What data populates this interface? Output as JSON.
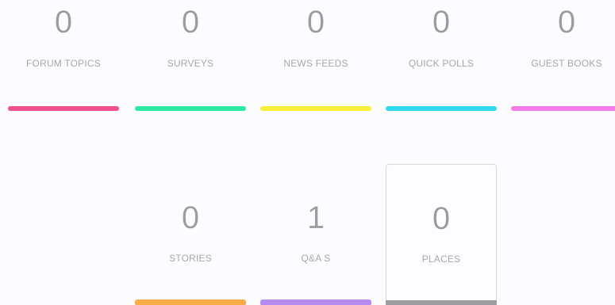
{
  "tiles": [
    {
      "count": "0",
      "label": "FORUM TOPICS",
      "color": "#f0508e"
    },
    {
      "count": "0",
      "label": "SURVEYS",
      "color": "#2ee8a2"
    },
    {
      "count": "0",
      "label": "NEWS FEEDS",
      "color": "#f6f03a"
    },
    {
      "count": "0",
      "label": "QUICK POLLS",
      "color": "#2fd8ec"
    },
    {
      "count": "0",
      "label": "GUEST BOOKS",
      "color": "#f47ae6"
    },
    {
      "count": "0",
      "label": "STORIES",
      "color": "#f8ad4a"
    },
    {
      "count": "1",
      "label": "Q&A S",
      "color": "#b78af0"
    },
    {
      "count": "0",
      "label": "PLACES",
      "color": "#9c9ca2"
    }
  ]
}
